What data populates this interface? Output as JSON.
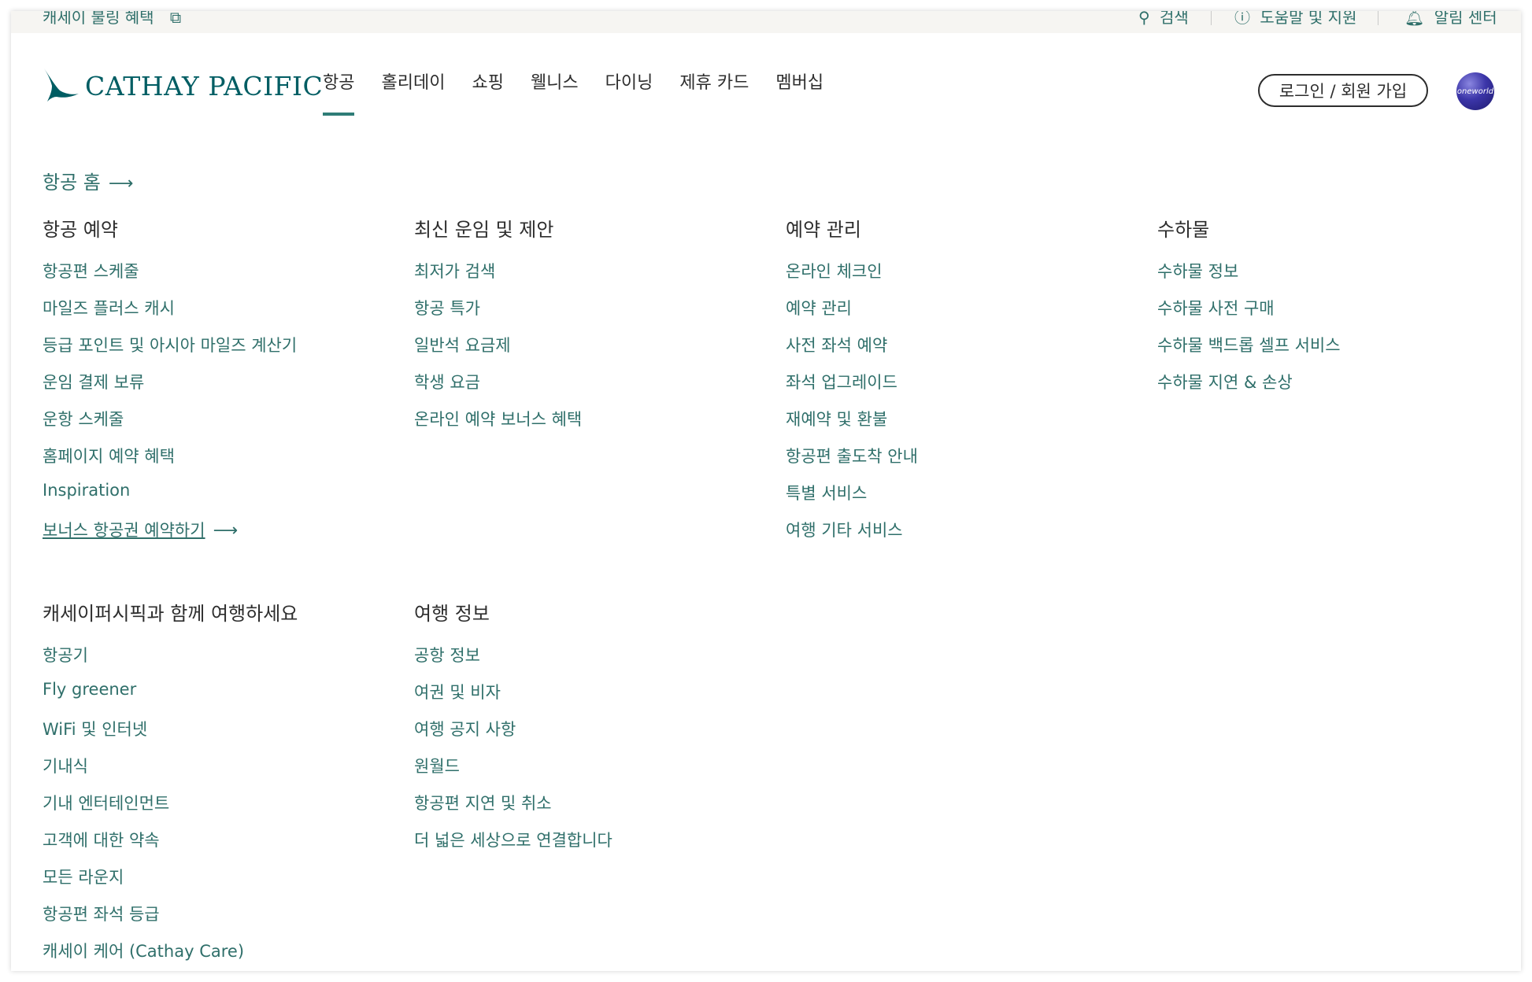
{
  "utility": {
    "left_text": "캐세이 불링 혜택",
    "search": "검색",
    "help": "도움말 및 지원",
    "notifications": "알림 센터"
  },
  "brand": {
    "name": "CATHAY PACIFIC",
    "color": "#005d63"
  },
  "nav": [
    {
      "label": "항공",
      "active": true
    },
    {
      "label": "홀리데이"
    },
    {
      "label": "쇼핑"
    },
    {
      "label": "웰니스"
    },
    {
      "label": "다이닝"
    },
    {
      "label": "제휴 카드"
    },
    {
      "label": "멤버십"
    }
  ],
  "account": {
    "login_label": "로그인 / 회원 가입",
    "alliance": "oneworld"
  },
  "menu": {
    "home_link": "항공 홈",
    "sections": [
      {
        "title": "항공 예약",
        "links": [
          "항공편 스케줄",
          "마일즈 플러스 캐시",
          "등급 포인트 및 아시아 마일즈 계산기",
          "운임 결제 보류",
          "운항 스케줄",
          "홈페이지 예약 혜택",
          "Inspiration",
          "보너스 항공권 예약하기"
        ]
      },
      {
        "title": "최신 운임 및 제안",
        "links": [
          "최저가 검색",
          "항공 특가",
          "일반석 요금제",
          "학생 요금",
          "온라인 예약 보너스 혜택"
        ]
      },
      {
        "title": "예약 관리",
        "links": [
          "온라인 체크인",
          "예약 관리",
          "사전 좌석 예약",
          "좌석 업그레이드",
          "재예약 및 환불",
          "항공편 출도착 안내",
          "특별 서비스",
          "여행 기타 서비스"
        ]
      },
      {
        "title": "수하물",
        "links": [
          "수하물 정보",
          "수하물 사전 구매",
          "수하물 백드롭 셀프 서비스",
          "수하물 지연 & 손상"
        ]
      },
      {
        "title": "캐세이퍼시픽과 함께 여행하세요",
        "links": [
          "항공기",
          "Fly greener",
          "WiFi 및 인터넷",
          "기내식",
          "기내 엔터테인먼트",
          "고객에 대한 약속",
          "모든 라운지",
          "항공편 좌석 등급",
          "캐세이 케어 (Cathay Care)"
        ]
      },
      {
        "title": "여행 정보",
        "links": [
          "공항 정보",
          "여권 및 비자",
          "여행 공지 사항",
          "원월드",
          "항공편 지연 및 취소",
          "더 넓은 세상으로 연결합니다"
        ]
      }
    ]
  }
}
